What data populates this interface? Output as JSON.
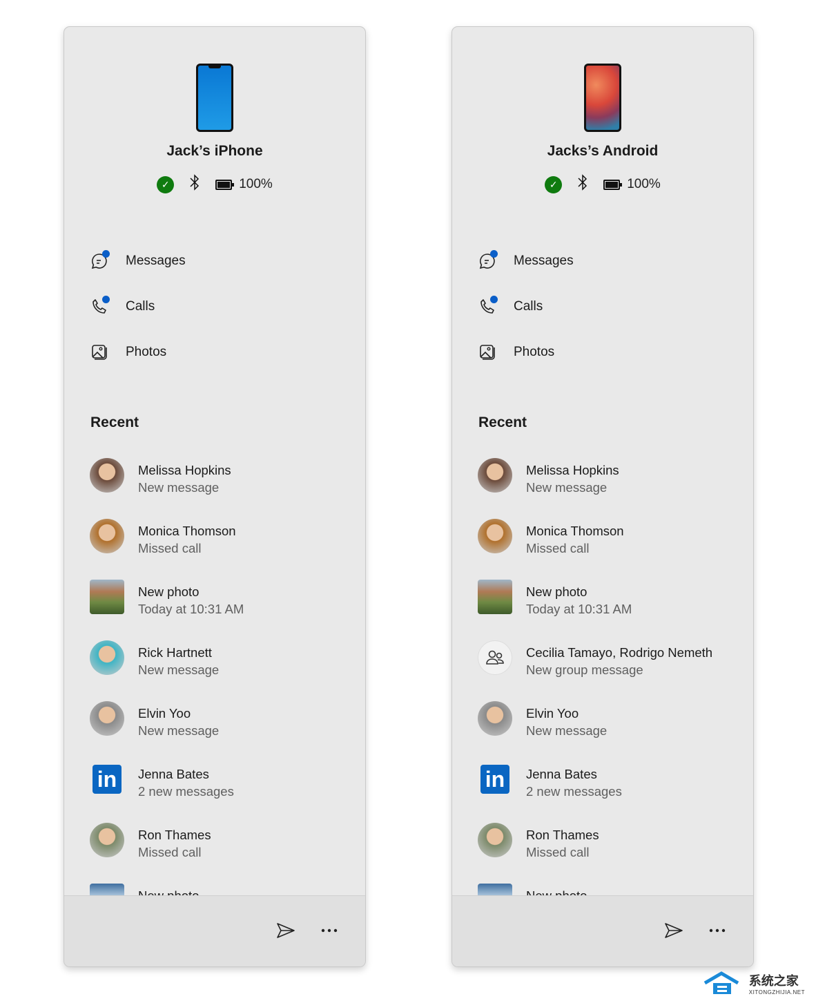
{
  "panels": [
    {
      "device_type": "ios",
      "device_name": "Jack’s iPhone",
      "battery": "100%",
      "menu": [
        {
          "label": "Messages",
          "icon": "message-icon",
          "badge": true
        },
        {
          "label": "Calls",
          "icon": "phone-icon",
          "badge": true
        },
        {
          "label": "Photos",
          "icon": "photo-icon",
          "badge": false
        }
      ],
      "recent_title": "Recent",
      "recent": [
        {
          "title": "Melissa Hopkins",
          "subtitle": "New message",
          "avatar": "person",
          "color": "#6b4a3a"
        },
        {
          "title": "Monica Thomson",
          "subtitle": "Missed call",
          "avatar": "person",
          "color": "#b0702c"
        },
        {
          "title": "New photo",
          "subtitle": "Today at 10:31 AM",
          "avatar": "photo",
          "color": "#6a8a4a"
        },
        {
          "title": "Rick Hartnett",
          "subtitle": "New message",
          "avatar": "person",
          "color": "#3fb4c4"
        },
        {
          "title": "Elvin Yoo",
          "subtitle": "New message",
          "avatar": "person",
          "color": "#8a8a8a"
        },
        {
          "title": "Jenna Bates",
          "subtitle": "2 new messages",
          "avatar": "linkedin",
          "color": "#0a66c2"
        },
        {
          "title": "Ron Thames",
          "subtitle": "Missed call",
          "avatar": "person",
          "color": "#7c8a6a"
        },
        {
          "title": "New photo",
          "subtitle": "",
          "avatar": "photo2",
          "color": "#5a8ab8"
        }
      ]
    },
    {
      "device_type": "android",
      "device_name": "Jacks’s Android",
      "battery": "100%",
      "menu": [
        {
          "label": "Messages",
          "icon": "message-icon",
          "badge": true
        },
        {
          "label": "Calls",
          "icon": "phone-icon",
          "badge": true
        },
        {
          "label": "Photos",
          "icon": "photo-icon",
          "badge": false
        }
      ],
      "recent_title": "Recent",
      "recent": [
        {
          "title": "Melissa Hopkins",
          "subtitle": "New message",
          "avatar": "person",
          "color": "#6b4a3a"
        },
        {
          "title": "Monica Thomson",
          "subtitle": "Missed call",
          "avatar": "person",
          "color": "#b0702c"
        },
        {
          "title": "New photo",
          "subtitle": "Today at 10:31 AM",
          "avatar": "photo",
          "color": "#6a8a4a"
        },
        {
          "title": "Cecilia Tamayo, Rodrigo Nemeth",
          "subtitle": "New group message",
          "avatar": "group",
          "color": "#f2f2f2"
        },
        {
          "title": "Elvin Yoo",
          "subtitle": "New message",
          "avatar": "person",
          "color": "#8a8a8a"
        },
        {
          "title": "Jenna Bates",
          "subtitle": "2 new messages",
          "avatar": "linkedin",
          "color": "#0a66c2"
        },
        {
          "title": "Ron Thames",
          "subtitle": "Missed call",
          "avatar": "person",
          "color": "#7c8a6a"
        },
        {
          "title": "New photo",
          "subtitle": "",
          "avatar": "photo2",
          "color": "#5a8ab8"
        }
      ]
    }
  ],
  "watermark": {
    "title": "系统之家",
    "subtitle": "XITONGZHIJIA.NET"
  }
}
